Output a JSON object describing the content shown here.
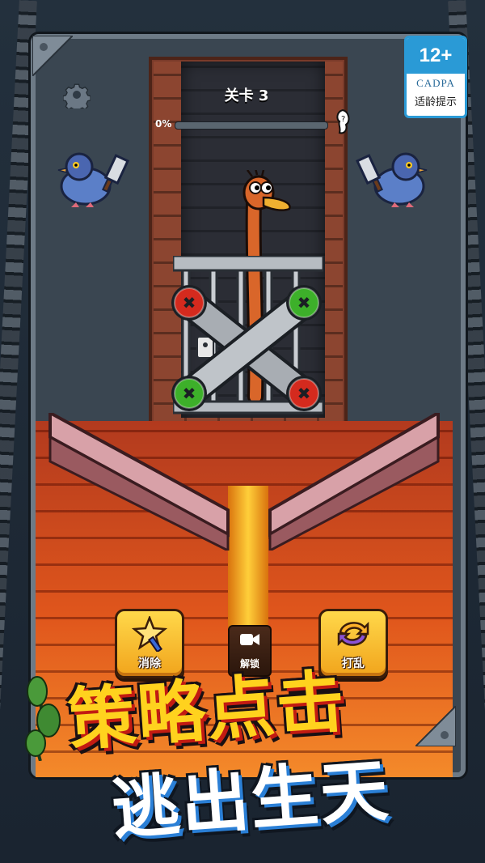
{
  "rating": {
    "age": "12+",
    "org": "CADPA",
    "tip": "适龄提示"
  },
  "hud": {
    "level_title": "关卡 3",
    "progress_text": "0%",
    "progress_value": 0
  },
  "buttons": {
    "clear": "消除",
    "unlock": "解锁",
    "shuffle": "打乱"
  },
  "promo": {
    "line1": "策略点击",
    "line2": "逃出生天"
  },
  "pins": [
    {
      "color": "red",
      "glyph": "✖"
    },
    {
      "color": "green",
      "glyph": "✖"
    },
    {
      "color": "green",
      "glyph": "✖"
    },
    {
      "color": "red",
      "glyph": "✖"
    }
  ],
  "colors": {
    "pin_red": "#d42a1e",
    "pin_green": "#3db02a",
    "accent_yellow": "#ffd21e",
    "lava": "#f48a2a"
  }
}
